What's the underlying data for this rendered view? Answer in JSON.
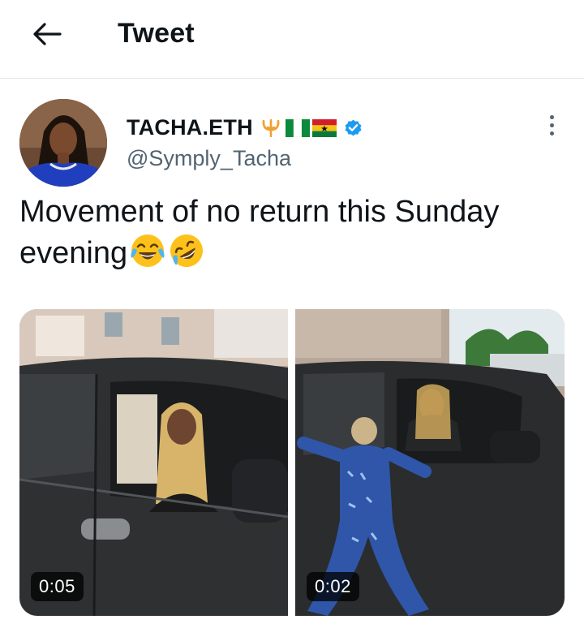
{
  "header": {
    "title": "Tweet",
    "back_icon": "arrow-left-icon"
  },
  "tweet": {
    "author": {
      "display_name": "TACHA.ETH",
      "name_symbols": [
        "trident-emoji",
        "nigeria-flag",
        "ghana-flag"
      ],
      "verified": true,
      "handle": "@Symply_Tacha"
    },
    "text": "Movement of no return this Sunday evening",
    "text_emojis": [
      "face-with-tears-of-joy",
      "rolling-on-floor-laughing"
    ],
    "media": [
      {
        "type": "video",
        "duration": "0:05"
      },
      {
        "type": "video",
        "duration": "0:02"
      }
    ]
  },
  "colors": {
    "text": "#0f1419",
    "secondary": "#536471",
    "verified": "#1d9bf0",
    "divider": "#e3e6e8"
  }
}
